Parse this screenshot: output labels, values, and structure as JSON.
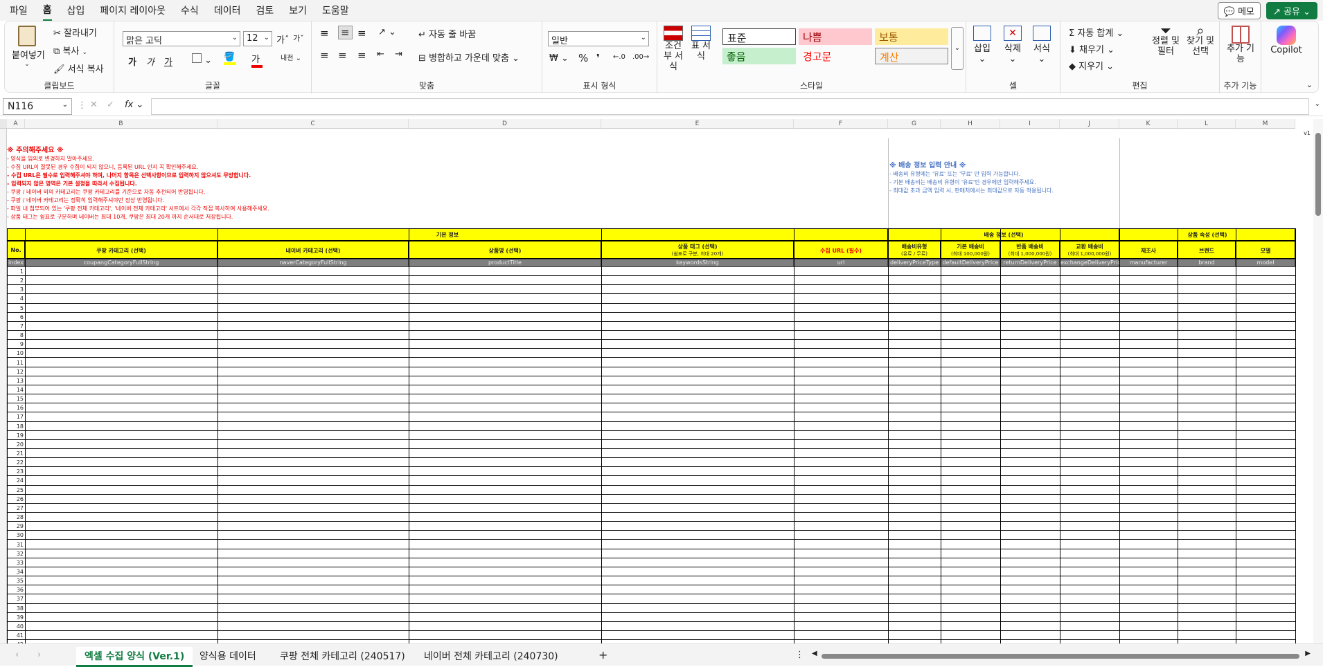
{
  "menu": [
    "파일",
    "홈",
    "삽입",
    "페이지 레이아웃",
    "수식",
    "데이터",
    "검토",
    "보기",
    "도움말"
  ],
  "top_right": {
    "memo": "메모",
    "share": "공유"
  },
  "ribbon": {
    "clipboard": {
      "paste": "붙여넣기",
      "cut": "잘라내기",
      "copy": "복사",
      "format_painter": "서식 복사",
      "label": "클립보드"
    },
    "font": {
      "name": "맑은 고딕",
      "size": "12",
      "bold": "가",
      "italic": "가",
      "underline": "가",
      "label": "글꼴"
    },
    "align": {
      "wrap": "자동 줄 바꿈",
      "merge": "병합하고 가운데 맞춤",
      "label": "맞춤"
    },
    "number": {
      "format": "일반",
      "label": "표시 형식"
    },
    "styles": {
      "conditional": "조건부 서식",
      "table": "표 서식",
      "normal": "표준",
      "bad": "나쁨",
      "neutral": "보통",
      "good": "좋음",
      "warning": "경고문",
      "calc": "계산",
      "label": "스타일"
    },
    "cells": {
      "insert": "삽입",
      "delete": "삭제",
      "format": "서식",
      "label": "셀"
    },
    "edit": {
      "autosum": "자동 합계",
      "fill": "채우기",
      "clear": "지우기",
      "sort": "정렬 및 필터",
      "find": "찾기 및 선택",
      "label": "편집"
    },
    "addins": {
      "label": "추가 기능",
      "btn": "추가 기능"
    },
    "copilot": "Copilot"
  },
  "namebox": "N116",
  "fx": "fx",
  "columns": [
    "A",
    "B",
    "C",
    "D",
    "E",
    "F",
    "G",
    "H",
    "I",
    "J",
    "K",
    "L",
    "M"
  ],
  "version": "v1",
  "notes_left": {
    "title": "※ 주의해주세요 ※",
    "lines": [
      "- 양식을 임의로 변경하지 말아주세요.",
      "- 수집 URL이 잘못된 경우 수집이 되지 않으니, 등록된 URL 인지 꼭 확인해주세요.",
      "- 수집 URL은 필수로 입력해주셔야 하며, 나머지 항목은 선택사항이므로 입력하지 않으셔도 무방합니다.",
      "- 입력되지 않은 영역은 기본 설정을 따라서 수집됩니다.",
      "- 쿠팡 / 네이버 외의 카테고리는 쿠팡 카테고리를 기준으로 자동 추천되어 반영됩니다.",
      "- 쿠팡 / 네이버 카테고리는 정확히 입력해주셔야만 정상 반영됩니다.",
      "- 파일 내 첨부되어 있는 '쿠팡 전체 카테고리', '네이버 전체 카테고리' 시트에서 각각 직접 복사하여 사용해주세요.",
      "- 상품 태그는 쉼표로 구분하며 네이버는 최대 10개, 쿠팡은 최대 20개 까지 순서대로 저장됩니다."
    ]
  },
  "notes_right": {
    "title": "※ 배송 정보 입력 안내 ※",
    "lines": [
      "- 배송비 유형에는 '유료' 또는 '무료' 만 입력 가능합니다.",
      "- 기본 배송비는 배송비 유형이 '유료'인 경우에만 입력해주세요.",
      "- 최대값 초과 금액 입력 시, 판매처에서는 최대값으로 자동 적용됩니다."
    ]
  },
  "groups": {
    "basic": "기본 정보",
    "shipping": "배송 정보 (선택)",
    "attr": "상품 속성 (선택)"
  },
  "headers": [
    {
      "t": "No.",
      "s": ""
    },
    {
      "t": "쿠팡 카테고리 (선택)",
      "s": ""
    },
    {
      "t": "네이버 카테고리 (선택)",
      "s": ""
    },
    {
      "t": "상품명 (선택)",
      "s": ""
    },
    {
      "t": "상품 태그 (선택)",
      "s": "(쉼표로 구분, 최대 20개)"
    },
    {
      "t": "수집 URL (필수)",
      "s": ""
    },
    {
      "t": "배송비유형",
      "s": "(유료 / 무료)"
    },
    {
      "t": "기본 배송비",
      "s": "(최대 100,000원)"
    },
    {
      "t": "반품 배송비",
      "s": "(최대 1,000,000원)"
    },
    {
      "t": "교환 배송비",
      "s": "(최대 1,000,000원)"
    },
    {
      "t": "제조사",
      "s": ""
    },
    {
      "t": "브랜드",
      "s": ""
    },
    {
      "t": "모델",
      "s": ""
    }
  ],
  "keys": [
    "index",
    "coupangCategoryFullString",
    "naverCategoryFullString",
    "productTitle",
    "keywordsString",
    "url",
    "deliveryPriceType",
    "defaultDeliveryPrice",
    "returnDeliveryPrice",
    "exchangeDeliveryPrice",
    "manufacturer",
    "brand",
    "model"
  ],
  "tabs": [
    "엑셀 수집 양식 (Ver.1)",
    "양식용 데이터",
    "쿠팡 전체 카테고리 (240517)",
    "네이버 전체 카테고리 (240730)"
  ],
  "add_tab": "+"
}
